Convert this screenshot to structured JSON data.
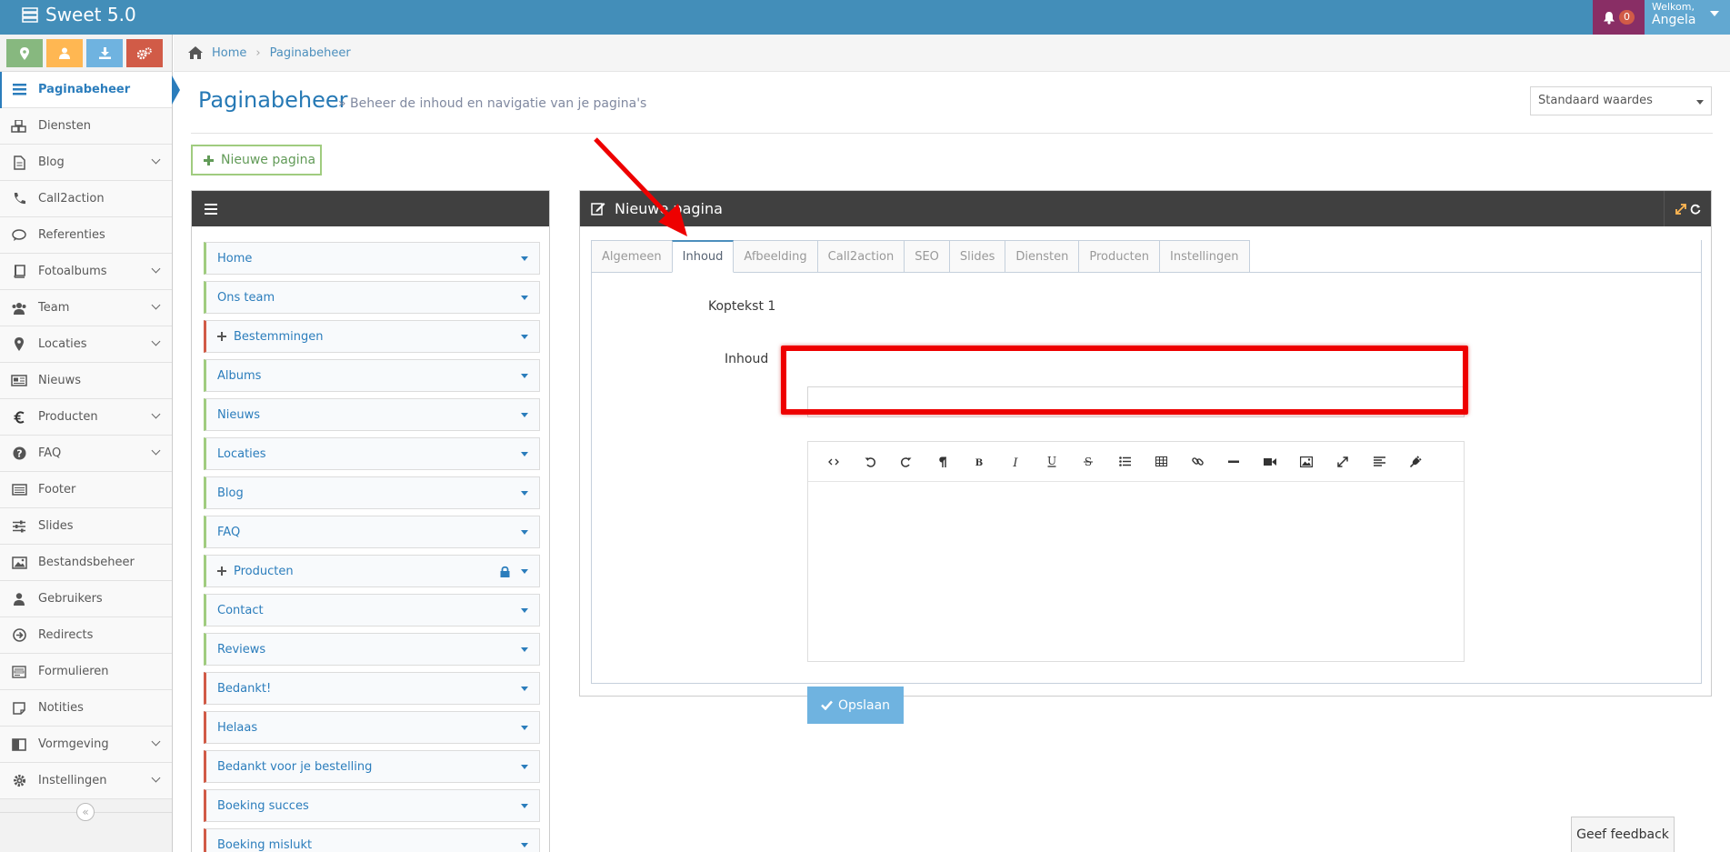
{
  "app": {
    "title": "Sweet 5.0"
  },
  "header": {
    "notifications_count": "0",
    "welcome": "Welkom,",
    "user_name": "Angela"
  },
  "shortcuts": [
    {
      "icon": "map-marker-icon",
      "color": "#87b87f"
    },
    {
      "icon": "user-icon",
      "color": "#ffb752"
    },
    {
      "icon": "download-icon",
      "color": "#6fb3e0"
    },
    {
      "icon": "cogs-icon",
      "color": "#d15b47"
    }
  ],
  "sidebar": {
    "items": [
      {
        "label": "Paginabeheer",
        "icon": "bars-icon",
        "active": true,
        "has_sub": false
      },
      {
        "label": "Diensten",
        "icon": "cubes-icon",
        "has_sub": false
      },
      {
        "label": "Blog",
        "icon": "file-text-icon",
        "has_sub": true
      },
      {
        "label": "Call2action",
        "icon": "phone-icon",
        "has_sub": false
      },
      {
        "label": "Referenties",
        "icon": "comment-icon",
        "has_sub": false
      },
      {
        "label": "Fotoalbums",
        "icon": "book-icon",
        "has_sub": true
      },
      {
        "label": "Team",
        "icon": "users-icon",
        "has_sub": true
      },
      {
        "label": "Locaties",
        "icon": "map-marker-icon",
        "has_sub": true
      },
      {
        "label": "Nieuws",
        "icon": "newspaper-icon",
        "has_sub": false
      },
      {
        "label": "Producten",
        "icon": "euro-icon",
        "has_sub": true
      },
      {
        "label": "FAQ",
        "icon": "question-circle-icon",
        "has_sub": true
      },
      {
        "label": "Footer",
        "icon": "list-alt-icon",
        "has_sub": false
      },
      {
        "label": "Slides",
        "icon": "sliders-icon",
        "has_sub": false
      },
      {
        "label": "Bestandsbeheer",
        "icon": "image-icon",
        "has_sub": false
      },
      {
        "label": "Gebruikers",
        "icon": "user-icon",
        "has_sub": false
      },
      {
        "label": "Redirects",
        "icon": "arrow-circle-icon",
        "has_sub": false
      },
      {
        "label": "Formulieren",
        "icon": "form-icon",
        "has_sub": false
      },
      {
        "label": "Notities",
        "icon": "sticky-note-icon",
        "has_sub": false
      },
      {
        "label": "Vormgeving",
        "icon": "columns-icon",
        "has_sub": true
      },
      {
        "label": "Instellingen",
        "icon": "gear-icon",
        "has_sub": true
      }
    ]
  },
  "breadcrumb": {
    "home": "Home",
    "current": "Paginabeheer"
  },
  "page": {
    "title": "Paginabeheer",
    "subtitle": "» Beheer de inhoud en navigatie van je pagina's",
    "select_value": "Standaard waardes",
    "new_page_button": "Nieuwe pagina"
  },
  "tree": {
    "items": [
      {
        "label": "Home",
        "color": "green"
      },
      {
        "label": "Ons team",
        "color": "green"
      },
      {
        "label": "Bestemmingen",
        "color": "red",
        "expandable": true
      },
      {
        "label": "Albums",
        "color": "green"
      },
      {
        "label": "Nieuws",
        "color": "green"
      },
      {
        "label": "Locaties",
        "color": "green"
      },
      {
        "label": "Blog",
        "color": "green"
      },
      {
        "label": "FAQ",
        "color": "green"
      },
      {
        "label": "Producten",
        "color": "green",
        "expandable": true,
        "locked": true
      },
      {
        "label": "Contact",
        "color": "green"
      },
      {
        "label": "Reviews",
        "color": "green"
      },
      {
        "label": "Bedankt!",
        "color": "red"
      },
      {
        "label": "Helaas",
        "color": "red"
      },
      {
        "label": "Bedankt voor je bestelling",
        "color": "red"
      },
      {
        "label": "Boeking succes",
        "color": "red"
      },
      {
        "label": "Boeking mislukt",
        "color": "red"
      }
    ]
  },
  "editor": {
    "title": "Nieuwe pagina",
    "tabs": [
      "Algemeen",
      "Inhoud",
      "Afbeelding",
      "Call2action",
      "SEO",
      "Slides",
      "Diensten",
      "Producten",
      "Instellingen"
    ],
    "active_tab": "Inhoud",
    "koptekst_label": "Koptekst 1",
    "koptekst_value": "",
    "inhoud_label": "Inhoud",
    "toolbar": [
      "code-view-icon",
      "undo-icon",
      "redo-icon",
      "paragraph-icon",
      "bold-icon",
      "italic-icon",
      "underline-icon",
      "strikethrough-icon",
      "list-icon",
      "table-icon",
      "link-icon",
      "horizontal-rule-icon",
      "video-icon",
      "image-icon",
      "fullscreen-icon",
      "align-icon",
      "plugin-icon"
    ],
    "save_button": "Opslaan"
  },
  "feedback": {
    "label": "Geef feedback"
  },
  "colors": {
    "topbar": "#438eb9",
    "link": "#2b7dbc",
    "panel_header": "#404040",
    "highlight": "#e00000"
  }
}
